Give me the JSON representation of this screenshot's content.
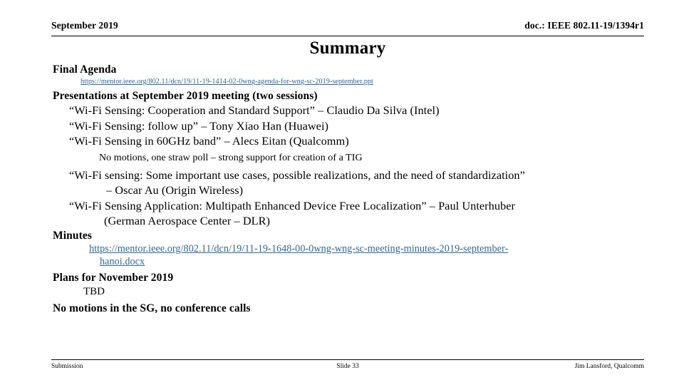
{
  "header": {
    "left": "September 2019",
    "right": "doc.: IEEE 802.11-19/1394r1"
  },
  "title": "Summary",
  "colors": {
    "hyperlink": "#31679A",
    "text": "#000000",
    "background": "#FFFFFF"
  },
  "content": {
    "final_agenda_heading": "Final Agenda",
    "final_agenda_link": "https://mentor.ieee.org/802.11/dcn/19/11-19-1414-02-0wng-agenda-for-wng-sc-2019-september.ppt",
    "presentations_heading": "Presentations at September 2019 meeting (two sessions)",
    "presentations": [
      "“Wi-Fi Sensing: Cooperation and Standard Support” – Claudio Da Silva (Intel)",
      "“Wi-Fi Sensing: follow up” – Tony Xiao Han (Huawei)",
      "“Wi-Fi Sensing in 60GHz band” – Alecs Eitan (Qualcomm)"
    ],
    "straw_poll_note": "No motions, one straw poll – strong support for creation of a TIG",
    "presentation_4_line1": "“Wi-Fi sensing: Some important use cases, possible realizations, and the need of standardization”",
    "presentation_4_line2": "– Oscar Au (Origin Wireless)",
    "presentation_5_line1": "“Wi-Fi Sensing Application: Multipath Enhanced Device Free Localization” – Paul Unterhuber",
    "presentation_5_line2": "(German Aerospace Center – DLR)",
    "minutes_heading": "Minutes",
    "minutes_link_line1": "https://mentor.ieee.org/802.11/dcn/19/11-19-1648-00-0wng-wng-sc-meeting-minutes-2019-september-",
    "minutes_link_line2": "hanoi.docx",
    "plans_heading": "Plans for November 2019",
    "plans_value": "TBD",
    "no_motions_heading": "No motions in the SG, no conference calls"
  },
  "footer": {
    "left": "Submission",
    "center": "Slide 33",
    "right": "Jim Lansford, Qualcomm"
  }
}
